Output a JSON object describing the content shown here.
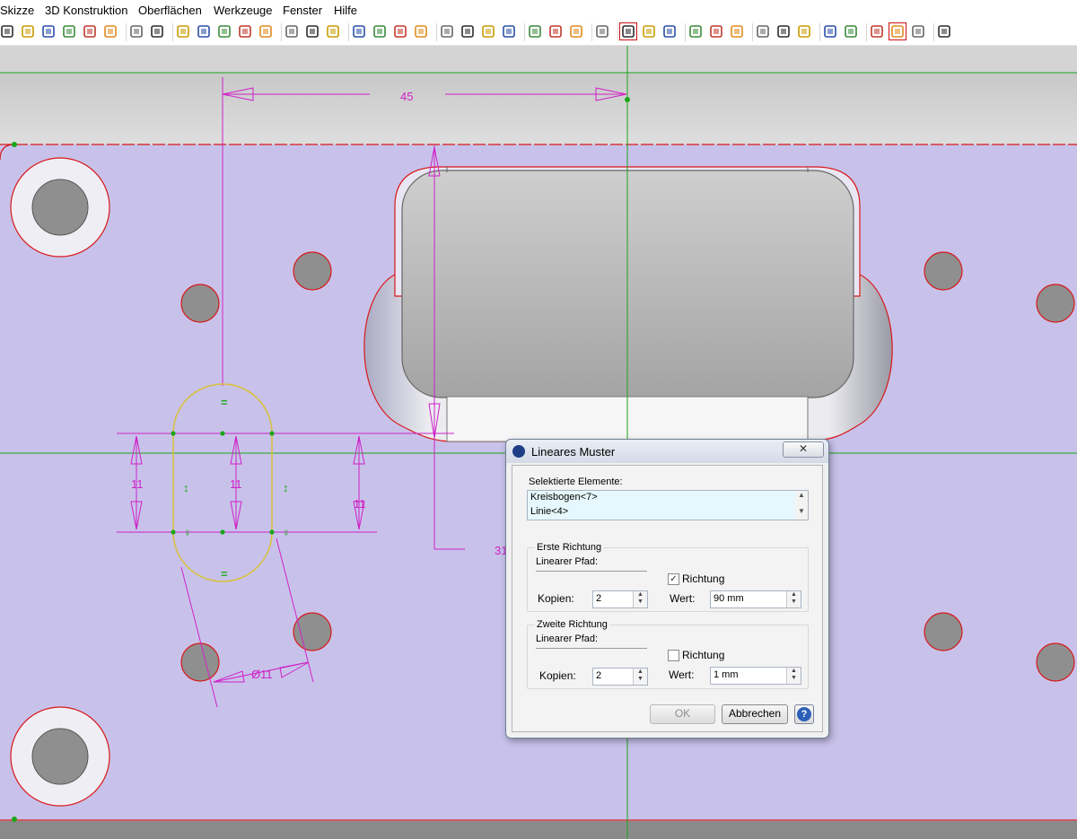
{
  "menubar": {
    "items": [
      "Skizze",
      "3D Konstruktion",
      "Oberflächen",
      "Werkzeuge",
      "Fenster",
      "Hilfe"
    ]
  },
  "toolbar": {
    "icons": [
      "iso-view-icon-1",
      "iso-view-icon-2",
      "iso-view-icon-3",
      "iso-view-icon-4",
      "iso-view-icon-5",
      "iso-view-icon-6",
      "view-dropdown-icon",
      "rotate-left-icon",
      "rotate-right-icon",
      "material-icon",
      "mesh-icon",
      "render-icon",
      "visibility-icon",
      "hide-icon",
      "constraint-icon",
      "intersect-icon",
      "cross-icon",
      "measure-icon",
      "document-icon",
      "paste-icon",
      "ruler-icon",
      "balance-icon",
      "align-icon",
      "distance-icon",
      "spacing-icon",
      "image-icon",
      "profile-icon",
      "export-icon",
      "sketch-edit-icon",
      "grid-icon",
      "grid-red-icon",
      "tools-icon",
      "select-arrow-icon",
      "move-icon",
      "undo-icon",
      "zoom-in-icon",
      "zoom-window-icon",
      "zoom-search-icon",
      "back-arrow-icon",
      "forward-arrow-icon",
      "shaded-box-icon",
      "wireframe-icon",
      "part-icon"
    ],
    "selected_icons": [
      "sketch-edit-icon",
      "shaded-box-icon"
    ]
  },
  "canvas": {
    "dim_horizontal": "45",
    "dim_height_left": "11",
    "dim_height_inner": "11",
    "dim_height_right": "11",
    "dim_diameter": "Ø11",
    "dim_partial": "31",
    "equal_symbol": "=",
    "constraint_arrow": "↕",
    "constraint_tangent": "♀",
    "colors": {
      "plate": "#c8c2ea",
      "outline": "#d81818",
      "dimension": "#d020c8",
      "axis": "#1aa51a",
      "sketch": "#d8c040",
      "hole_fill": "#8f8f8f"
    }
  },
  "dialog": {
    "title": "Lineares Muster",
    "close_label": "✕",
    "selected_label": "Selektierte Elemente:",
    "selected_items": [
      "Kreisbogen<7>",
      "Linie<4>"
    ],
    "first_direction": {
      "title": "Erste Richtung",
      "path_label": "Linearer Pfad:",
      "direction_label": "Richtung",
      "direction_checked": true,
      "copies_label": "Kopien:",
      "copies_value": "2",
      "value_label": "Wert:",
      "value": "90 mm"
    },
    "second_direction": {
      "title": "Zweite Richtung",
      "path_label": "Linearer Pfad:",
      "direction_label": "Richtung",
      "direction_checked": false,
      "copies_label": "Kopien:",
      "copies_value": "2",
      "value_label": "Wert:",
      "value": "1 mm"
    },
    "ok_label": "OK",
    "cancel_label": "Abbrechen",
    "help_label": "?"
  }
}
